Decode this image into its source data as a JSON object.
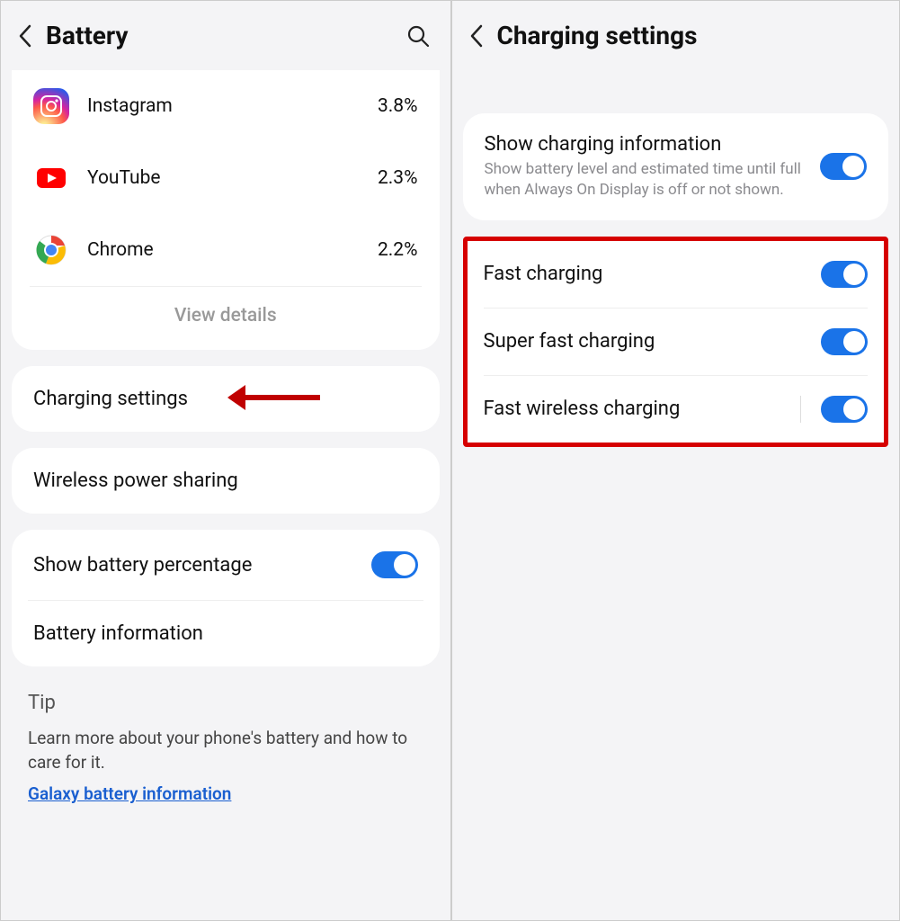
{
  "left": {
    "title": "Battery",
    "apps": [
      {
        "name": "Instagram",
        "pct": "3.8%"
      },
      {
        "name": "YouTube",
        "pct": "2.3%"
      },
      {
        "name": "Chrome",
        "pct": "2.2%"
      }
    ],
    "view_details": "View details",
    "charging_settings": "Charging settings",
    "wireless_power_sharing": "Wireless power sharing",
    "show_battery_percentage": "Show battery percentage",
    "battery_information": "Battery information",
    "tip": {
      "title": "Tip",
      "body": "Learn more about your phone's battery and how to care for it.",
      "link": "Galaxy battery information"
    }
  },
  "right": {
    "title": "Charging settings",
    "show_info": {
      "label": "Show charging information",
      "sub": "Show battery level and estimated time until full when Always On Display is off or not shown."
    },
    "fast_charging": "Fast charging",
    "super_fast_charging": "Super fast charging",
    "fast_wireless_charging": "Fast wireless charging"
  }
}
